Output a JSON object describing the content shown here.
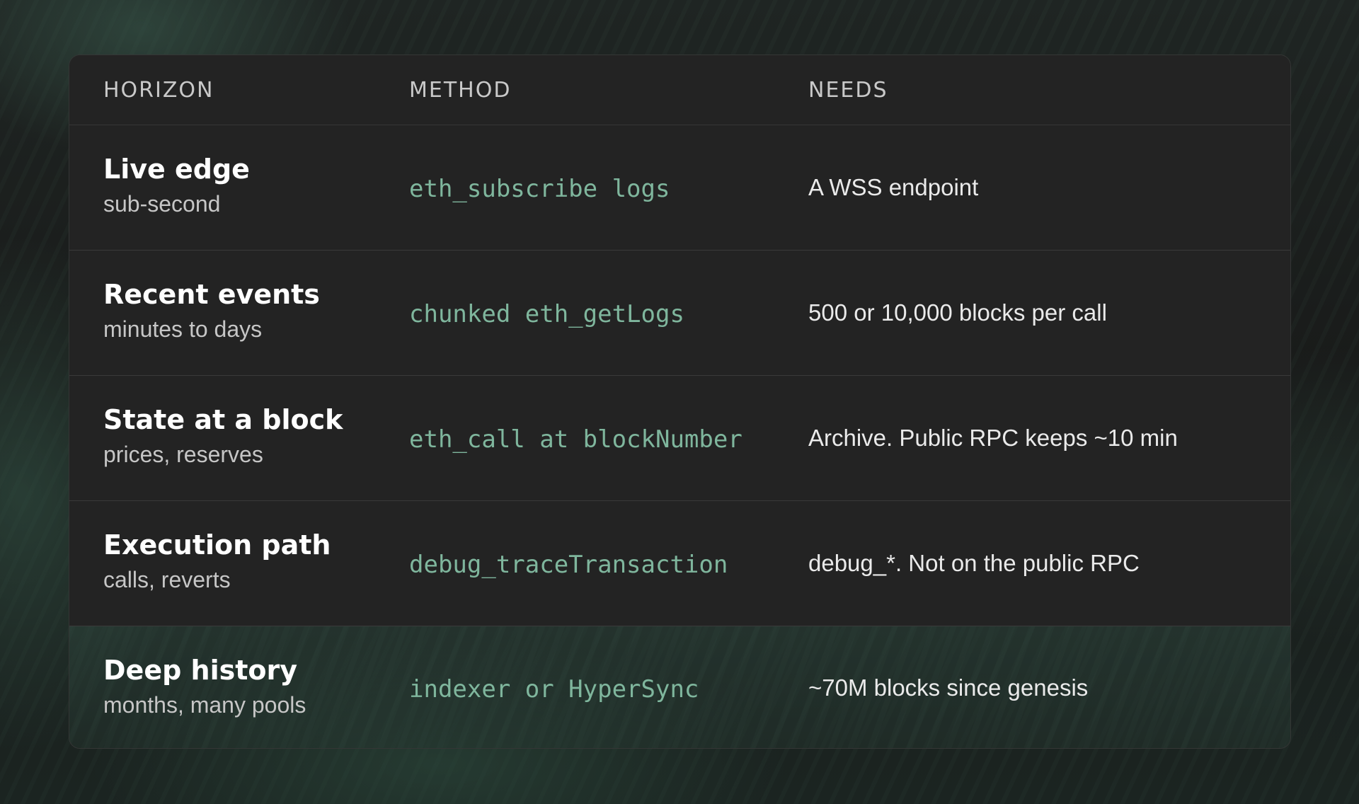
{
  "table": {
    "headers": {
      "horizon": "HORIZON",
      "method": "METHOD",
      "needs": "NEEDS"
    },
    "rows": [
      {
        "horizon": "Live edge",
        "horizon_sub": "sub-second",
        "method": "eth_subscribe logs",
        "needs": "A WSS endpoint"
      },
      {
        "horizon": "Recent events",
        "horizon_sub": "minutes to days",
        "method": "chunked eth_getLogs",
        "needs": "500 or 10,000 blocks per call"
      },
      {
        "horizon": "State at a block",
        "horizon_sub": "prices, reserves",
        "method": "eth_call at blockNumber",
        "needs": "Archive. Public RPC keeps ~10 min"
      },
      {
        "horizon": "Execution path",
        "horizon_sub": "calls, reverts",
        "method": "debug_traceTransaction",
        "needs": "debug_*. Not on the public RPC"
      },
      {
        "horizon": "Deep history",
        "horizon_sub": "months, many pools",
        "method": "indexer or HyperSync",
        "needs": "~70M blocks since genesis"
      }
    ]
  },
  "colors": {
    "method_text": "#7fb69d",
    "row_background": "#232323",
    "title_text": "#ffffff",
    "subtitle_text": "#c6c6c6"
  }
}
